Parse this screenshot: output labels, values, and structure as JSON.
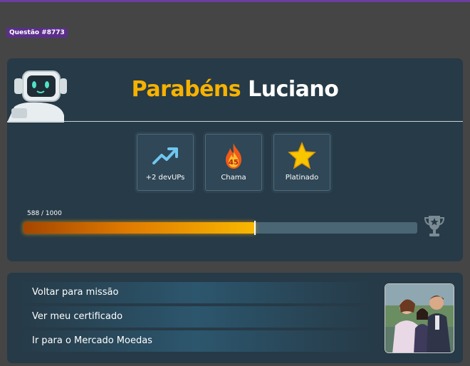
{
  "question_badge": "Questão #8773",
  "header": {
    "title_highlight": "Parabéns",
    "title_name": "Luciano"
  },
  "badges": [
    {
      "label": "+2 devUPs",
      "icon": "trending-up-icon"
    },
    {
      "label": "Chama",
      "icon": "flame-icon",
      "value": "45"
    },
    {
      "label": "Platinado",
      "icon": "star-icon"
    }
  ],
  "progress": {
    "label": "588 / 1000",
    "current": 588,
    "total": 1000
  },
  "links": [
    {
      "label": "Voltar para missão"
    },
    {
      "label": "Ver meu certificado"
    },
    {
      "label": "Ir para o Mercado Moedas"
    }
  ],
  "colors": {
    "accent": "#f7b200",
    "card_bg": "#263a47",
    "page_bg": "#454545",
    "badge_purple": "#5b2f8a"
  }
}
